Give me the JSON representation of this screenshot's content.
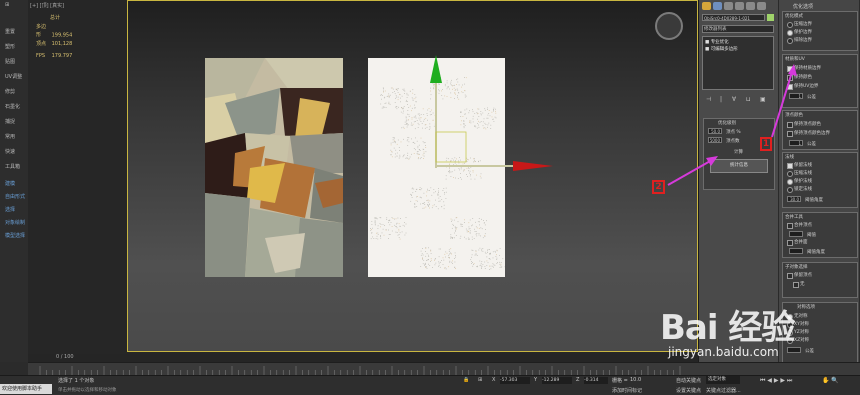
{
  "viewport_header": "[+] [顶] [真实]",
  "stats": {
    "title": "总计",
    "rows": [
      {
        "label": "多边形",
        "value": "199,954"
      },
      {
        "label": "顶点",
        "value": "101,128"
      }
    ],
    "fps_label": "FPS",
    "fps_value": "179.797"
  },
  "left_menu": [
    "重置",
    "塑形",
    "贴图",
    "UV调整",
    "修剪",
    "石墨化",
    "捕捉",
    "常用",
    "快速",
    "工具箱"
  ],
  "left_menu_blue": [
    "建模",
    "自由形式",
    "选择",
    "对象绘制",
    "模型选择"
  ],
  "command_panel": {
    "object_name": "ObjSrc0-4D0289-1-021",
    "modifier_list_label": "修改器列表",
    "stack": [
      "专业优化",
      "可编辑多边形"
    ],
    "optimize_group": "优化级别",
    "optimize_pct_label": "顶点 %",
    "optimize_pct_value": "50.0",
    "vertex_count_label": "顶点数",
    "vertex_count_value": "5000",
    "calc_button": "计算",
    "stat_button": "统计信息",
    "stat_text": "统计信息"
  },
  "rollout": {
    "title": "优化选项",
    "mode_title": "优化模式",
    "mode_options": [
      "压缩边界",
      "保护边界",
      "排除边界"
    ],
    "material_title": "材质和UV",
    "material_options": [
      "保持材质边界",
      "保持颜色",
      "保持UV边界"
    ],
    "uv_spinner": "1",
    "uv_label": "公差",
    "vertex_color_title": "顶点颜色",
    "vertex_color_options": [
      "保持顶点颜色",
      "保持顶点颜色边界"
    ],
    "normals_title": "法线",
    "normals_options": [
      "保留法线",
      "压缩法线",
      "保护法线",
      "锁定法线"
    ],
    "normals_angle_label": "阈值角度",
    "normals_angle_value": "30.0",
    "merge_title": "合并工具",
    "merge_options": [
      "合并顶点",
      "合并面"
    ],
    "merge_threshold": "阈值",
    "symmetry_title": "子对象选择",
    "symmetry_options": [
      "保留顶点"
    ],
    "symmetry_value": "无",
    "symmetry_section": "对称选项",
    "symmetry_choices": [
      "无对称",
      "XY对称",
      "YZ对称",
      "XZ对称"
    ],
    "symmetry_tolerance": "公差"
  },
  "callouts": [
    "1",
    "2"
  ],
  "timeline": "0 / 100",
  "status": {
    "selected": "选择了 1 个对象",
    "hint": "单击并拖动以选择和移动对象",
    "x_label": "X",
    "x_value": "-57.303",
    "y_label": "Y",
    "y_value": "-12.289",
    "z_label": "Z",
    "z_value": "-0.314",
    "grid_label": "栅格 =",
    "grid_value": "10.0",
    "autokey": "自动关键点",
    "setkey": "设置关键点",
    "selected_obj": "选定对象",
    "key_filter": "关键点过滤器...",
    "add_time": "添加时间标记"
  },
  "welcome": "欢迎使用脚本助手",
  "watermark": {
    "logo": "Bai 经验",
    "url": "jingyan.baidu.com"
  },
  "colors": {
    "viewport_border": "#c9b640",
    "callout": "#e02020",
    "arrow": "#d63adb",
    "gizmo_y": "#1fae1f",
    "gizmo_x": "#c81818"
  }
}
